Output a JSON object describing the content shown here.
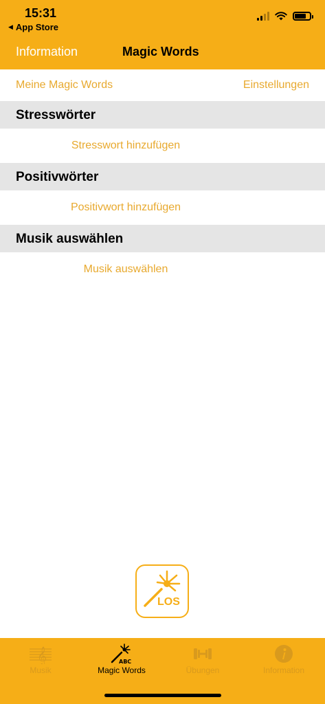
{
  "status_bar": {
    "time": "15:31",
    "back_app": "App Store",
    "back_icon": "triangle-left-icon",
    "icons": [
      "cellular-signal-icon",
      "wifi-icon",
      "battery-icon"
    ]
  },
  "nav": {
    "back_label": "Information",
    "title": "Magic Words"
  },
  "links": {
    "left": "Meine Magic Words",
    "right": "Einstellungen"
  },
  "sections": [
    {
      "header": "Stresswörter",
      "action": "Stresswort hinzufügen"
    },
    {
      "header": "Positivwörter",
      "action": "Positivwort hinzufügen"
    },
    {
      "header": "Musik auswählen",
      "action": "Musik auswählen"
    }
  ],
  "los_button": {
    "label": "LOS",
    "icon": "magic-wand-icon"
  },
  "tabs": [
    {
      "label": "Musik",
      "icon": "treble-clef-icon",
      "active": false
    },
    {
      "label": "Magic Words",
      "icon": "magic-wand-abc-icon",
      "active": true
    },
    {
      "label": "Übungen",
      "icon": "dumbbell-icon",
      "active": false
    },
    {
      "label": "Information",
      "icon": "info-icon",
      "active": false
    }
  ],
  "colors": {
    "accent": "#F6AE17",
    "link_text": "#E8A92E",
    "section_bg": "#E5E5E5",
    "inactive_tab": "#D99A1D"
  }
}
